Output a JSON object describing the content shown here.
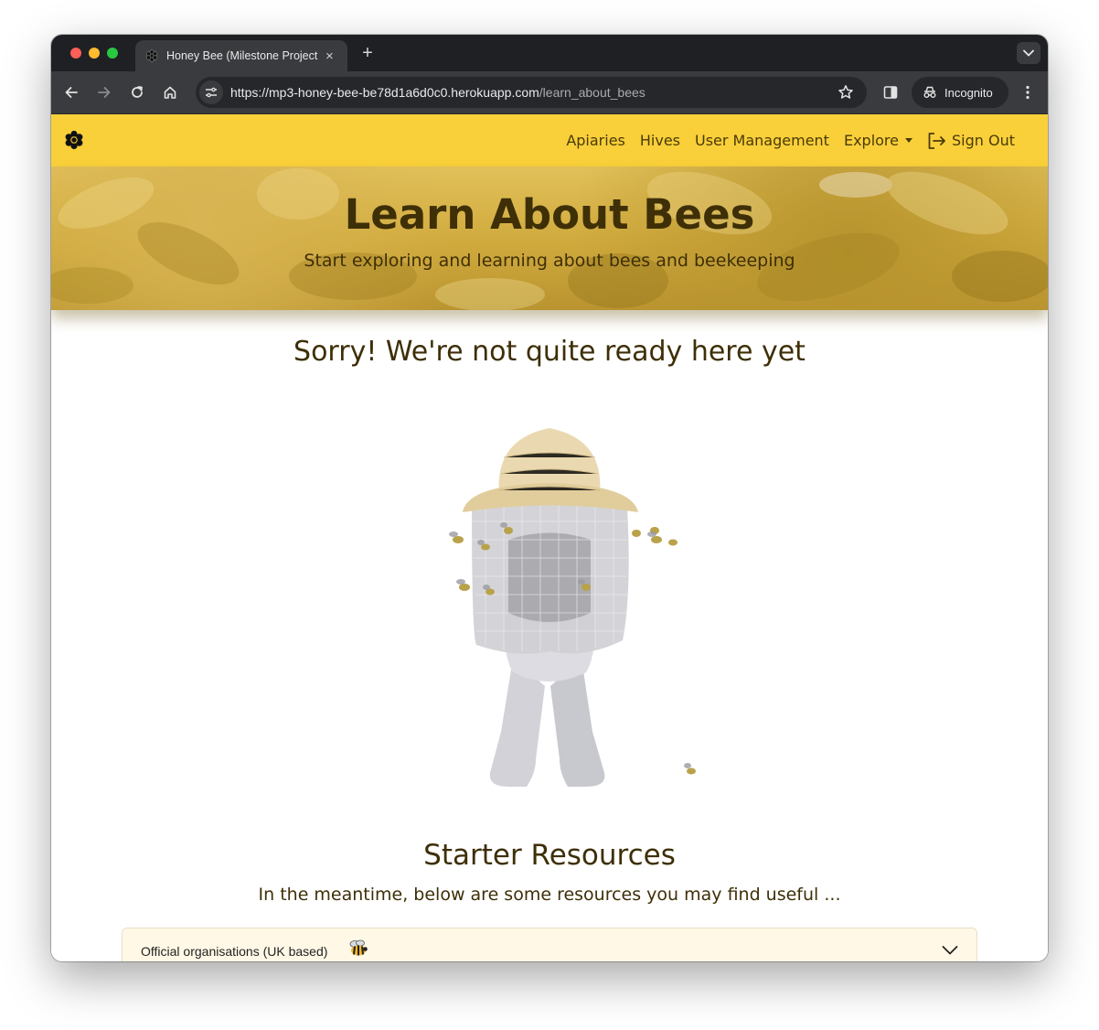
{
  "browser": {
    "tab_title": "Honey Bee (Milestone Project",
    "tab_close": "×",
    "new_tab": "+",
    "url_host": "https://mp3-honey-bee-be78d1a6d0c0.herokuapp.com",
    "url_path": "/learn_about_bees",
    "incognito_label": "Incognito"
  },
  "nav": {
    "items": [
      {
        "label": "Apiaries"
      },
      {
        "label": "Hives"
      },
      {
        "label": "User Management"
      },
      {
        "label": "Explore"
      },
      {
        "label": "Sign Out"
      }
    ]
  },
  "hero": {
    "title": "Learn About Bees",
    "subtitle": "Start exploring and learning about bees and beekeeping"
  },
  "main": {
    "sorry": "Sorry! We're not quite ready here yet",
    "starter_title": "Starter Resources",
    "starter_subtitle": "In the meantime, below are some resources you may find useful ...",
    "accordion_label": "Official organisations (UK based)"
  },
  "colors": {
    "navbar": "#f9d03a",
    "text_brown": "#3e2f07",
    "hero_gold": "#cfa93c",
    "accordion_bg": "#fff8e6"
  }
}
